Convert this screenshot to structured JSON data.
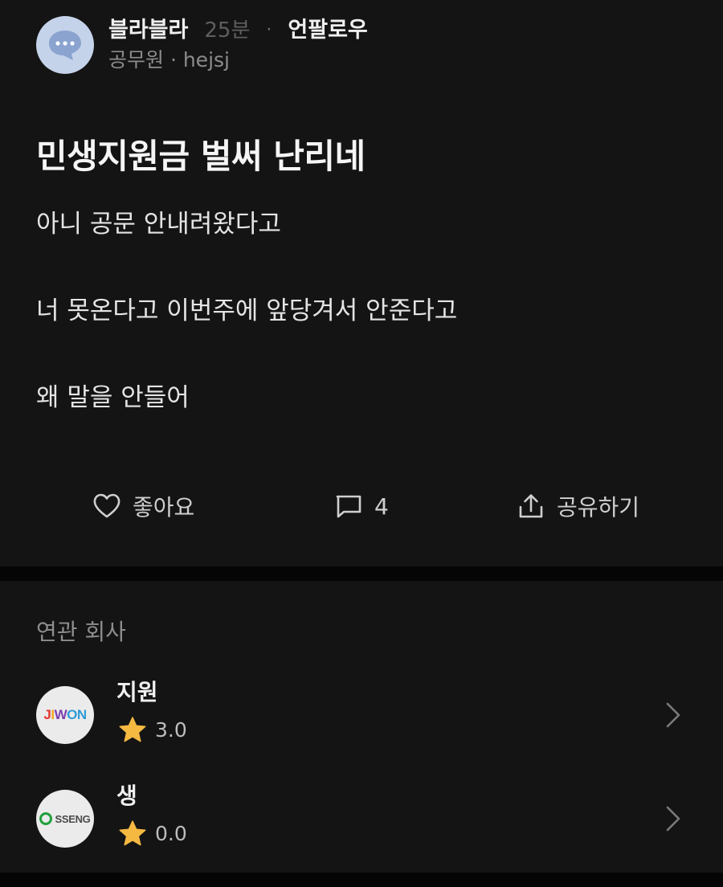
{
  "post": {
    "author_name": "블라블라",
    "time": "25분",
    "separator": "·",
    "unfollow_label": "언팔로우",
    "author_meta": "공무원 · hejsj",
    "title": "민생지원금 벌써 난리네",
    "body": [
      "아니 공문 안내려왔다고",
      "너 못온다고 이번주에 앞당겨서 안준다고",
      "왜 말을 안들어"
    ]
  },
  "actions": {
    "like_label": "좋아요",
    "comment_count": "4",
    "share_label": "공유하기"
  },
  "related": {
    "title": "연관 회사",
    "companies": [
      {
        "name": "지원",
        "rating": "3.0",
        "logo_letters": [
          "J",
          "I",
          "W",
          "O",
          "N"
        ],
        "logo_colors": [
          "#e2382f",
          "#f2a81d",
          "#7a3fb0",
          "#2f9bd6",
          "#2f9bd6"
        ]
      },
      {
        "name": "생",
        "rating": "0.0",
        "logo_text": "SSENG"
      }
    ]
  },
  "colors": {
    "background": "#141414",
    "divider": "#050505",
    "star": "#f5b942",
    "avatar_bg": "#c5d3ea",
    "avatar_icon": "#8aa3cf"
  },
  "icons": {
    "avatar": "speech-bubble-icon",
    "like": "heart-outline-icon",
    "comment": "comment-outline-icon",
    "share": "share-upload-icon",
    "rating": "star-icon",
    "row_arrow": "chevron-right-icon"
  }
}
